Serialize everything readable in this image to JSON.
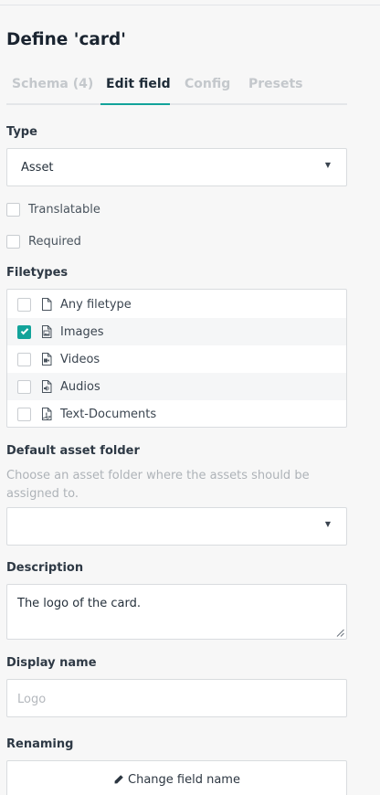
{
  "header": {
    "title": "Define 'card'"
  },
  "tabs": [
    {
      "label": "Schema (4)",
      "active": false
    },
    {
      "label": "Edit field",
      "active": true
    },
    {
      "label": "Config",
      "active": false
    },
    {
      "label": "Presets",
      "active": false
    }
  ],
  "type": {
    "label": "Type",
    "value": "Asset",
    "caret": "▼"
  },
  "options": {
    "translatable": {
      "label": "Translatable",
      "checked": false
    },
    "required": {
      "label": "Required",
      "checked": false
    }
  },
  "filetypes": {
    "label": "Filetypes",
    "items": [
      {
        "label": "Any filetype",
        "checked": false,
        "icon": "file-icon"
      },
      {
        "label": "Images",
        "checked": true,
        "icon": "image-file-icon"
      },
      {
        "label": "Videos",
        "checked": false,
        "icon": "video-file-icon"
      },
      {
        "label": "Audios",
        "checked": false,
        "icon": "audio-file-icon"
      },
      {
        "label": "Text-Documents",
        "checked": false,
        "icon": "pdf-file-icon"
      }
    ]
  },
  "asset_folder": {
    "label": "Default asset folder",
    "hint": "Choose an asset folder where the assets should be assigned to.",
    "value": "",
    "caret": "▼"
  },
  "description": {
    "label": "Description",
    "value": "The logo of the card."
  },
  "display_name": {
    "label": "Display name",
    "placeholder": "Logo"
  },
  "renaming": {
    "label": "Renaming",
    "button_label": "Change field name"
  },
  "colors": {
    "accent": "#12a39a",
    "text": "#1b2733",
    "muted": "#c4c8cc",
    "border": "#d9dcdf"
  }
}
